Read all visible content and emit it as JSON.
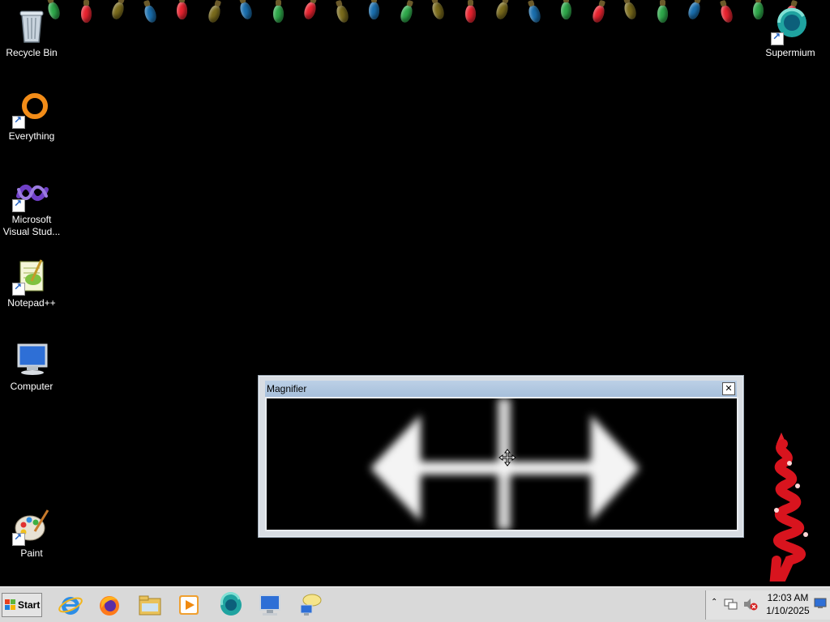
{
  "desktop": {
    "icons": [
      {
        "label": "Recycle Bin",
        "icon": "recycle-bin-icon"
      },
      {
        "label": "Everything",
        "icon": "everything-icon"
      },
      {
        "label": "Microsoft Visual Stud...",
        "icon": "visual-studio-icon"
      },
      {
        "label": "Notepad++",
        "icon": "notepad-plus-plus-icon"
      },
      {
        "label": "Computer",
        "icon": "computer-icon"
      },
      {
        "label": "Paint",
        "icon": "paint-icon"
      },
      {
        "label": "Supermium",
        "icon": "supermium-icon"
      }
    ]
  },
  "magnifier": {
    "title": "Magnifier",
    "close_glyph": "✕"
  },
  "taskbar": {
    "start_label": "Start",
    "pinned": [
      {
        "icon": "internet-explorer-icon"
      },
      {
        "icon": "firefox-icon"
      },
      {
        "icon": "file-explorer-icon"
      },
      {
        "icon": "media-player-icon"
      },
      {
        "icon": "supermium-icon"
      },
      {
        "icon": "remote-desktop-icon"
      },
      {
        "icon": "network-chat-icon"
      }
    ],
    "tray": {
      "chevron": "⌃",
      "time": "12:03 AM",
      "date": "1/10/2025"
    }
  },
  "colors": {
    "desktop_bg": "#000000",
    "taskbar_bg": "#d9d9d9",
    "magnifier_title_bar": "#a6bfdb",
    "bulb_colors": [
      "#2ea84a",
      "#e8232f",
      "#7a6b1c",
      "#1a6fae"
    ]
  }
}
